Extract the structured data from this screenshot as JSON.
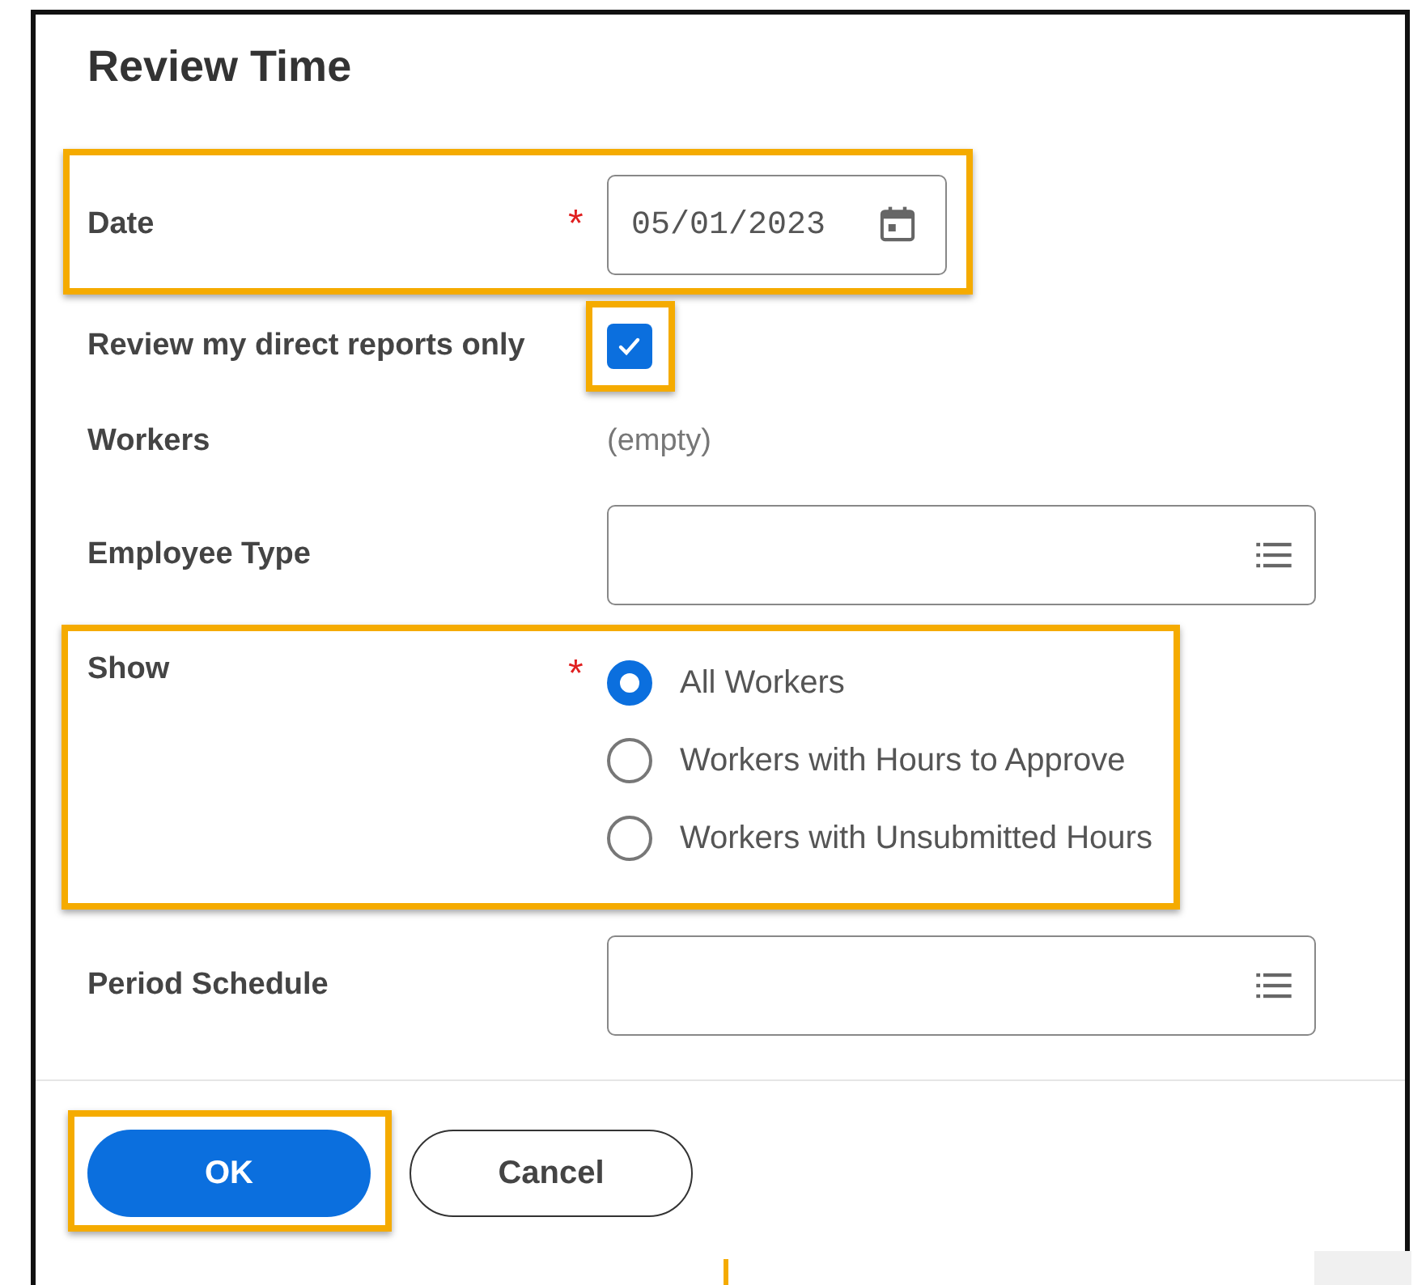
{
  "dialog": {
    "title": "Review Time",
    "fields": [
      {
        "kind": "date",
        "label": "Date",
        "required_mark": "*",
        "value": "05/01/2023",
        "highlighted": true
      },
      {
        "kind": "checkbox",
        "label": "Review my direct reports only",
        "checked": true,
        "highlighted": true
      },
      {
        "kind": "text",
        "label": "Workers",
        "value": "(empty)"
      },
      {
        "kind": "select",
        "label": "Employee Type"
      },
      {
        "kind": "radio",
        "label": "Show",
        "required_mark": "*",
        "highlighted": true,
        "options": [
          {
            "label": "All Workers",
            "selected": true
          },
          {
            "label": "Workers with Hours to Approve",
            "selected": false
          },
          {
            "label": "Workers with Unsubmitted Hours",
            "selected": false
          }
        ]
      },
      {
        "kind": "select",
        "label": "Period Schedule"
      }
    ],
    "buttons": [
      {
        "kind": "primary",
        "label": "OK",
        "highlighted": true
      },
      {
        "kind": "secondary",
        "label": "Cancel"
      }
    ]
  }
}
